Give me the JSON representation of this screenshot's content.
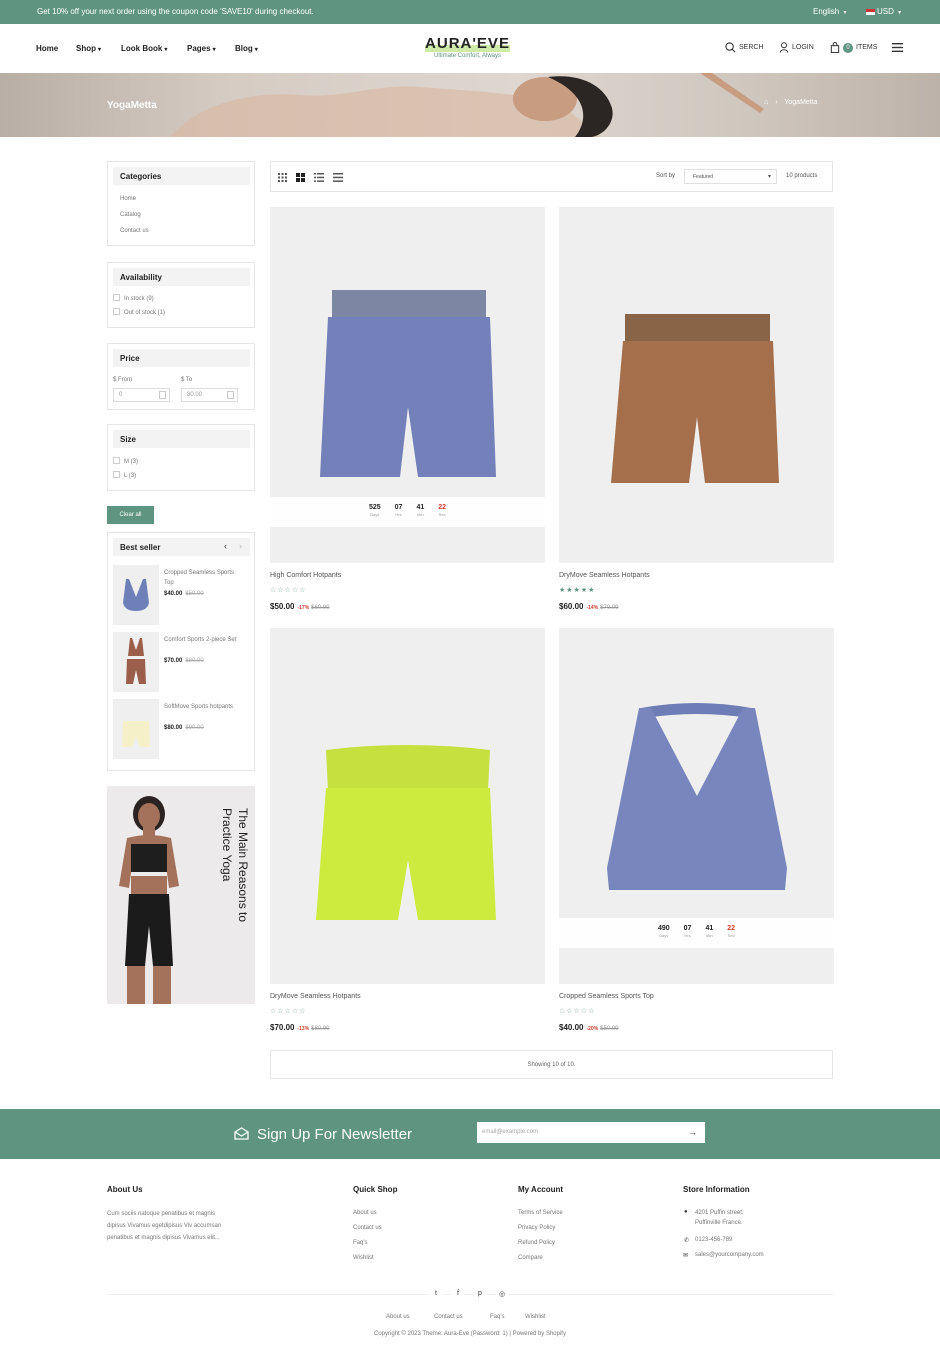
{
  "topbar": {
    "promo": "Get 10% off your next order using the coupon code 'SAVE10' during checkout.",
    "language": "English",
    "currency": "USD"
  },
  "nav": {
    "items": [
      "Home",
      "Shop",
      "Look Book",
      "Pages",
      "Blog"
    ]
  },
  "logo": {
    "name": "AURA'EVE",
    "tagline": "Ultimate Comfort, Always"
  },
  "header_actions": {
    "search": "SERCH",
    "login": "LOGIN",
    "cart_count": "0",
    "cart_label": "ITEMS"
  },
  "banner": {
    "title": "YogaMetta",
    "crumb_current": "YogaMetta"
  },
  "sidebar": {
    "categories": {
      "title": "Categories",
      "items": [
        "Home",
        "Catalog",
        "Contact us"
      ]
    },
    "availability": {
      "title": "Availability",
      "in_stock": "In stock (9)",
      "out_of_stock": "Out of stock (1)"
    },
    "price": {
      "title": "Price",
      "from_label": "$ From",
      "to_label": "$ To",
      "from_placeholder": "0",
      "to_placeholder": "80.00"
    },
    "size": {
      "title": "Size",
      "items": [
        "M (3)",
        "L (3)"
      ]
    },
    "clear_all": "Clear all",
    "best_seller": {
      "title": "Best seller",
      "items": [
        {
          "name": "Cropped Seamless Sports Top",
          "price": "$40.00",
          "old": "$50.00"
        },
        {
          "name": "Comfort Sports 2-piece Set",
          "price": "$70.00",
          "old": "$80.00"
        },
        {
          "name": "SoftMove Sports hotpants",
          "price": "$80.00",
          "old": "$90.00"
        }
      ]
    },
    "promo_text": "The Main Reasons to Practice Yoga"
  },
  "toolbar": {
    "sort_label": "Sort by",
    "sort_value": "Featured",
    "count": "10 products"
  },
  "products": [
    {
      "name": "High Comfort Hotpants",
      "price": "$50.00",
      "discount": "-17%",
      "old": "$60.00",
      "stars": "☆☆☆☆☆",
      "rating": 0,
      "timer": {
        "days": "525",
        "hrs": "07",
        "min": "41",
        "sec": "22"
      }
    },
    {
      "name": "DryMove Seamless Hotpants",
      "price": "$60.00",
      "discount": "-14%",
      "old": "$70.00",
      "stars": "★★★★★",
      "rating": 5
    },
    {
      "name": "DryMove Seamless Hotpants",
      "price": "$70.00",
      "discount": "-13%",
      "old": "$80.00",
      "stars": "☆☆☆☆☆",
      "rating": 0
    },
    {
      "name": "Cropped Seamless Sports Top",
      "price": "$40.00",
      "discount": "-20%",
      "old": "$50.00",
      "stars": "☆☆☆☆☆",
      "rating": 0,
      "timer": {
        "days": "490",
        "hrs": "07",
        "min": "41",
        "sec": "22"
      }
    }
  ],
  "timer_labels": {
    "days": "Days",
    "hrs": "Hrs",
    "min": "Min",
    "sec": "Sec"
  },
  "showing": "Showing 10 of 10.",
  "newsletter": {
    "title": "Sign Up For Newsletter",
    "placeholder": "email@example.com"
  },
  "footer": {
    "about": {
      "title": "About Us",
      "lines": [
        "Cum sociis natoque penatibus et magnis",
        "dipisus Vivamus egetdipisus Viv accumsan",
        "penatibus et magnis dipisus Vivamus elit..."
      ]
    },
    "quick_shop": {
      "title": "Quick Shop",
      "items": [
        "About us",
        "Contact us",
        "Faq's",
        "Wishlist"
      ]
    },
    "my_account": {
      "title": "My Account",
      "items": [
        "Terms of Service",
        "Privacy Policy",
        "Refund Policy",
        "Compare"
      ]
    },
    "store": {
      "title": "Store Information",
      "address1": "4201 Puffin street,",
      "address2": "Puffinville France.",
      "phone": "0123-456-789",
      "email": "sales@yourcompany.com"
    },
    "bottom_links": [
      "About us",
      "Contact us",
      "Faq's",
      "Wishlist"
    ],
    "copyright": "Copyright © 2023 Theme: Aura-Eve (Password: 1) | Powered by Shopify"
  },
  "colors": {
    "accent": "#5e9480",
    "sale": "#d23b2b"
  }
}
